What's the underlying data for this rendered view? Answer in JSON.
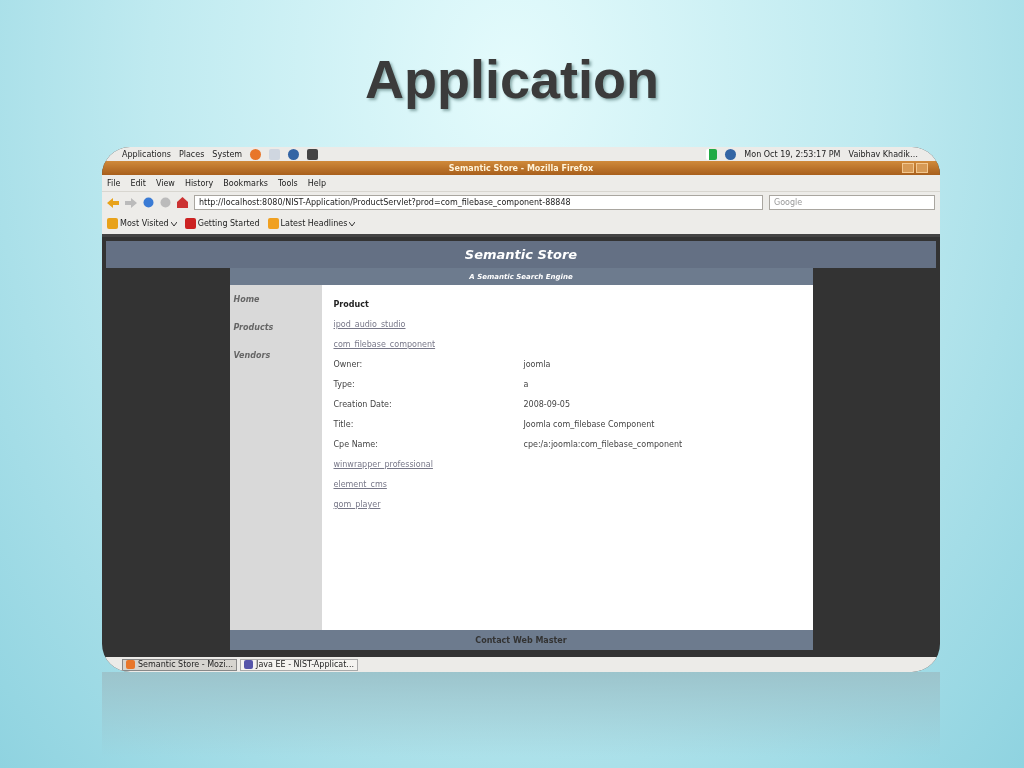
{
  "slide_title": "Application",
  "top_panel": {
    "menus": [
      "Applications",
      "Places",
      "System"
    ],
    "clock": "Mon Oct 19,  2:53:17 PM",
    "user": "Vaibhav Khadik…"
  },
  "browser": {
    "title": "Semantic Store - Mozilla Firefox",
    "menu": [
      "File",
      "Edit",
      "View",
      "History",
      "Bookmarks",
      "Tools",
      "Help"
    ],
    "url": "http://localhost:8080/NIST-Application/ProductServlet?prod=com_filebase_component-88848",
    "search_placeholder": "Google",
    "bookmarks": [
      {
        "label": "Most Visited",
        "dropdown": true
      },
      {
        "label": "Getting Started",
        "dropdown": false
      },
      {
        "label": "Latest Headlines",
        "dropdown": true
      }
    ]
  },
  "page": {
    "site_title": "Semantic Store",
    "tagline": "A Semantic Search Engine",
    "nav": [
      "Home",
      "Products",
      "Vendors"
    ],
    "heading": "Product",
    "rows": [
      {
        "kind": "link",
        "text": "ipod_audio_studio"
      },
      {
        "kind": "link",
        "text": "com_filebase_component"
      },
      {
        "kind": "field",
        "label": "Owner:",
        "value": "joomla"
      },
      {
        "kind": "field",
        "label": "Type:",
        "value": "a"
      },
      {
        "kind": "field",
        "label": "Creation Date:",
        "value": "2008-09-05"
      },
      {
        "kind": "field",
        "label": "Title:",
        "value": "Joomla com_filebase Component"
      },
      {
        "kind": "field",
        "label": "Cpe Name:",
        "value": "cpe:/a:joomla:com_filebase_component"
      },
      {
        "kind": "link",
        "text": "winwrapper_professional"
      },
      {
        "kind": "link",
        "text": "element_cms"
      },
      {
        "kind": "link",
        "text": "gom_player"
      }
    ],
    "footer": "Contact Web Master"
  },
  "taskbar": [
    {
      "label": "Semantic Store - Mozi...",
      "selected": true
    },
    {
      "label": "Java EE - NIST-Applicat...",
      "selected": false
    }
  ]
}
